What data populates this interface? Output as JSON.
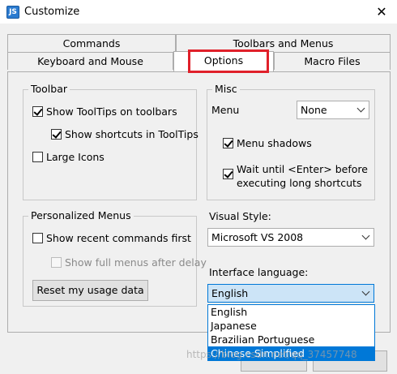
{
  "window": {
    "title": "Customize",
    "icon_text": "JS"
  },
  "tabs": {
    "row_back": [
      "Commands",
      "Toolbars and Menus"
    ],
    "row_front": [
      "Keyboard and Mouse",
      "Options",
      "Macro Files"
    ]
  },
  "toolbar_group": {
    "title": "Toolbar",
    "show_tooltips": "Show ToolTips on toolbars",
    "show_shortcuts": "Show shortcuts in ToolTips",
    "large_icons": "Large Icons"
  },
  "misc_group": {
    "title": "Misc",
    "menu_label": "Menu",
    "menu_value": "None",
    "menu_shadows": "Menu shadows",
    "wait_enter": "Wait until <Enter> before executing long shortcuts"
  },
  "personalized_group": {
    "title": "Personalized Menus",
    "show_recent": "Show recent commands first",
    "show_full": "Show full menus after delay",
    "reset_button": "Reset my usage data"
  },
  "visual_style": {
    "label": "Visual Style:",
    "value": "Microsoft VS 2008"
  },
  "interface_language": {
    "label": "Interface language:",
    "value": "English",
    "options": [
      "English",
      "Japanese",
      "Brazilian Portuguese",
      "Chinese Simplified"
    ],
    "highlighted_option": "Chinese Simplified"
  },
  "watermark": "https://blog.csdn.net/qq_37457748",
  "colors": {
    "accent": "#0078d7",
    "highlight_box": "#e0202a"
  }
}
